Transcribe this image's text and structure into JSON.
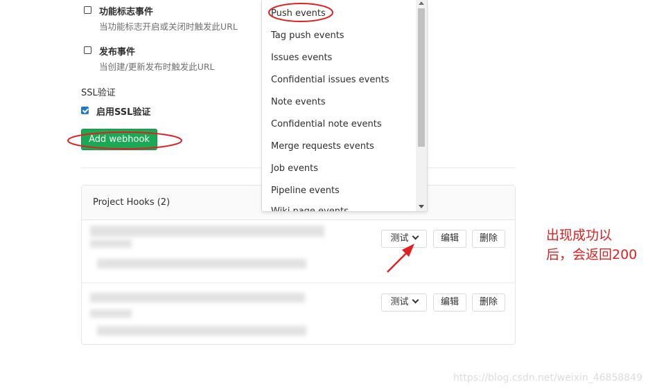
{
  "options": [
    {
      "label": "功能标志事件",
      "help": "当功能标志开启或关闭时触发此URL"
    },
    {
      "label": "发布事件",
      "help": "当创建/更新发布时触发此URL"
    }
  ],
  "ssl": {
    "title": "SSL验证",
    "checkbox_label": "启用SSL验证",
    "checked": true
  },
  "add_button": "Add webhook",
  "dropdown": {
    "items": [
      "Push events",
      "Tag push events",
      "Issues events",
      "Confidential issues events",
      "Note events",
      "Confidential note events",
      "Merge requests events",
      "Job events",
      "Pipeline events",
      "Wiki page events"
    ]
  },
  "hooks": {
    "title": "Project Hooks (2)",
    "rows": [
      {
        "test": "测试",
        "edit": "编辑",
        "delete": "删除"
      },
      {
        "test": "测试",
        "edit": "编辑",
        "delete": "删除"
      }
    ]
  },
  "annotation": {
    "line1": "出现成功以",
    "line2": "后，会返回200"
  },
  "watermark": "https://blog.csdn.net/weixin_46858849",
  "colors": {
    "accent_green": "#1aaa55",
    "annotation_red": "#e02020",
    "checkbox_blue": "#1f78d1"
  }
}
